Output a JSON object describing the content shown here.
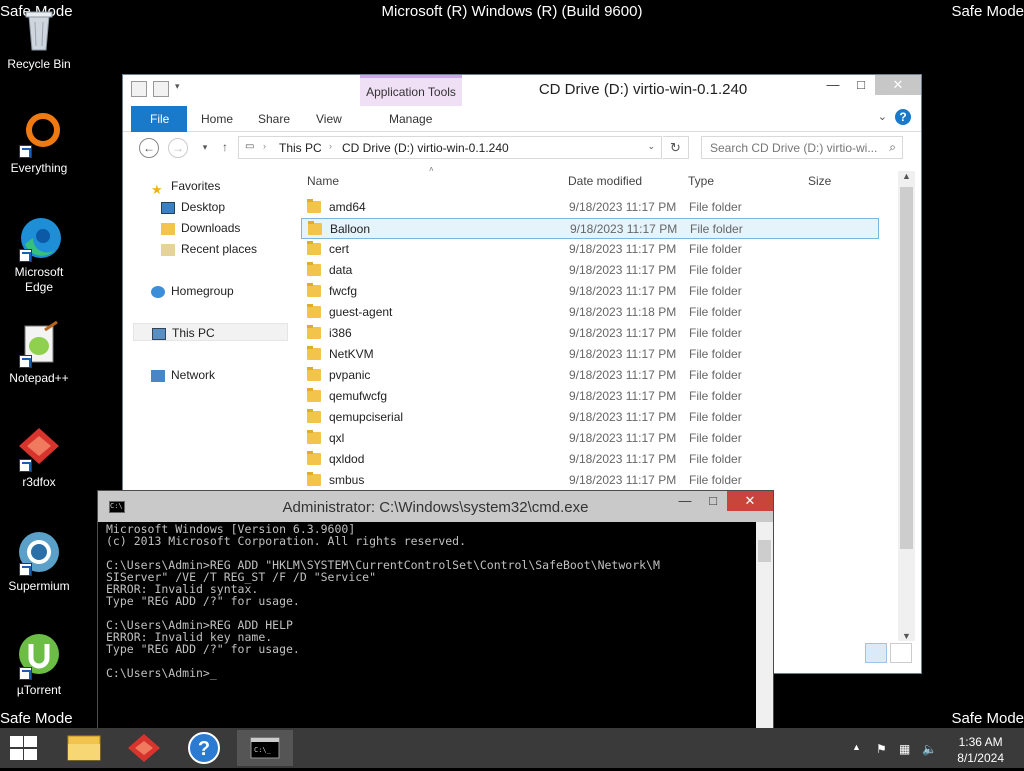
{
  "desktop": {
    "build_text": "Microsoft (R) Windows (R) (Build 9600)",
    "safe_mode": "Safe Mode",
    "icons": [
      {
        "label": "Recycle Bin",
        "icon": "recycle-bin-icon"
      },
      {
        "label": "Everything",
        "icon": "everything-icon"
      },
      {
        "label": "Microsoft Edge",
        "icon": "edge-icon"
      },
      {
        "label": "Notepad++",
        "icon": "notepadpp-icon"
      },
      {
        "label": "r3dfox",
        "icon": "r3dfox-icon"
      },
      {
        "label": "Supermium",
        "icon": "supermium-icon"
      },
      {
        "label": "µTorrent",
        "icon": "utorrent-icon"
      }
    ]
  },
  "explorer": {
    "title": "CD Drive (D:) virtio-win-0.1.240",
    "context_tab": "Application Tools",
    "ribbon_tabs": [
      "File",
      "Home",
      "Share",
      "View",
      "Manage"
    ],
    "breadcrumb": [
      "This PC",
      "CD Drive (D:) virtio-win-0.1.240"
    ],
    "search_placeholder": "Search CD Drive (D:) virtio-wi...",
    "nav": {
      "favorites": "Favorites",
      "desktop": "Desktop",
      "downloads": "Downloads",
      "recent": "Recent places",
      "homegroup": "Homegroup",
      "thispc": "This PC",
      "network": "Network"
    },
    "columns": [
      "Name",
      "Date modified",
      "Type",
      "Size"
    ],
    "selected_item": "Balloon",
    "files": [
      {
        "name": "amd64",
        "date": "9/18/2023 11:17 PM",
        "type": "File folder"
      },
      {
        "name": "Balloon",
        "date": "9/18/2023 11:17 PM",
        "type": "File folder"
      },
      {
        "name": "cert",
        "date": "9/18/2023 11:17 PM",
        "type": "File folder"
      },
      {
        "name": "data",
        "date": "9/18/2023 11:17 PM",
        "type": "File folder"
      },
      {
        "name": "fwcfg",
        "date": "9/18/2023 11:17 PM",
        "type": "File folder"
      },
      {
        "name": "guest-agent",
        "date": "9/18/2023 11:18 PM",
        "type": "File folder"
      },
      {
        "name": "i386",
        "date": "9/18/2023 11:17 PM",
        "type": "File folder"
      },
      {
        "name": "NetKVM",
        "date": "9/18/2023 11:17 PM",
        "type": "File folder"
      },
      {
        "name": "pvpanic",
        "date": "9/18/2023 11:17 PM",
        "type": "File folder"
      },
      {
        "name": "qemufwcfg",
        "date": "9/18/2023 11:17 PM",
        "type": "File folder"
      },
      {
        "name": "qemupciserial",
        "date": "9/18/2023 11:17 PM",
        "type": "File folder"
      },
      {
        "name": "qxl",
        "date": "9/18/2023 11:17 PM",
        "type": "File folder"
      },
      {
        "name": "qxldod",
        "date": "9/18/2023 11:17 PM",
        "type": "File folder"
      },
      {
        "name": "smbus",
        "date": "9/18/2023 11:17 PM",
        "type": "File folder"
      }
    ]
  },
  "cmd": {
    "title": "Administrator: C:\\Windows\\system32\\cmd.exe",
    "lines": [
      "Microsoft Windows [Version 6.3.9600]",
      "(c) 2013 Microsoft Corporation. All rights reserved.",
      "",
      "C:\\Users\\Admin>REG ADD \"HKLM\\SYSTEM\\CurrentControlSet\\Control\\SafeBoot\\Network\\M",
      "SIServer\" /VE /T REG_ST /F /D \"Service\"",
      "ERROR: Invalid syntax.",
      "Type \"REG ADD /?\" for usage.",
      "",
      "C:\\Users\\Admin>REG ADD HELP",
      "ERROR: Invalid key name.",
      "Type \"REG ADD /?\" for usage.",
      "",
      "C:\\Users\\Admin>_"
    ]
  },
  "taskbar": {
    "time": "1:36 AM",
    "date": "8/1/2024"
  }
}
